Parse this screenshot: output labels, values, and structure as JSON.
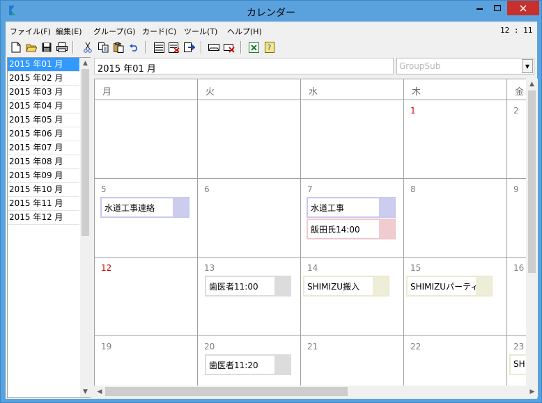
{
  "window": {
    "title": "カレンダー"
  },
  "menu": [
    {
      "label": "ファイル(F)"
    },
    {
      "label": "編集(E)"
    },
    {
      "label": "グループ(G)"
    },
    {
      "label": "カード(C)"
    },
    {
      "label": "ツール(T)"
    },
    {
      "label": "ヘルプ(H)"
    }
  ],
  "clock": "12 : 11",
  "toolbar": [
    {
      "icon": "new-file-icon"
    },
    {
      "icon": "open-folder-icon"
    },
    {
      "icon": "save-icon"
    },
    {
      "icon": "print-icon"
    },
    {
      "icon": "cut-icon"
    },
    {
      "icon": "copy-icon"
    },
    {
      "icon": "paste-icon"
    },
    {
      "icon": "undo-icon"
    },
    {
      "icon": "list-icon"
    },
    {
      "icon": "delete-list-icon"
    },
    {
      "icon": "exit-icon"
    },
    {
      "icon": "card-icon"
    },
    {
      "icon": "delete-card-icon"
    },
    {
      "icon": "excel-icon"
    },
    {
      "icon": "help-icon"
    }
  ],
  "months": [
    "2015 年01 月",
    "2015 年02 月",
    "2015 年03 月",
    "2015 年04 月",
    "2015 年05 月",
    "2015 年06 月",
    "2015 年07 月",
    "2015 年08 月",
    "2015 年09 月",
    "2015 年10 月",
    "2015 年11 月",
    "2015 年12 月"
  ],
  "selected_month_index": 0,
  "current_month": "2015 年01 月",
  "group_combo": {
    "value": "GroupSub"
  },
  "weekdays": [
    "月",
    "火",
    "水",
    "木",
    "金"
  ],
  "weeks": [
    [
      {
        "day": ""
      },
      {
        "day": ""
      },
      {
        "day": ""
      },
      {
        "day": "1",
        "red": true
      },
      {
        "day": "2"
      }
    ],
    [
      {
        "day": "5",
        "events": [
          {
            "text": "水道工事連絡",
            "color": "blue"
          }
        ]
      },
      {
        "day": "6"
      },
      {
        "day": "7",
        "events": [
          {
            "text": "水道工事",
            "color": "blue"
          },
          {
            "text": "飯田氏14:00",
            "color": "pink"
          }
        ]
      },
      {
        "day": "8"
      },
      {
        "day": "9"
      }
    ],
    [
      {
        "day": "12",
        "red": true
      },
      {
        "day": "13",
        "events": [
          {
            "text": "歯医者11:00",
            "color": "gray"
          }
        ]
      },
      {
        "day": "14",
        "events": [
          {
            "text": "SHIMIZU搬入",
            "color": "yellow"
          }
        ]
      },
      {
        "day": "15",
        "events": [
          {
            "text": "SHIMIZUパーティ",
            "color": "yellow"
          }
        ]
      },
      {
        "day": "16"
      }
    ],
    [
      {
        "day": "19"
      },
      {
        "day": "20",
        "events": [
          {
            "text": "歯医者11:20",
            "color": "gray"
          }
        ]
      },
      {
        "day": "21"
      },
      {
        "day": "22"
      },
      {
        "day": "23",
        "events": [
          {
            "text": "SH",
            "color": "yellow"
          }
        ]
      }
    ]
  ],
  "colors": {
    "selection": "#3399ff",
    "holiday": "#d00000",
    "close_button": "#c7302b"
  }
}
